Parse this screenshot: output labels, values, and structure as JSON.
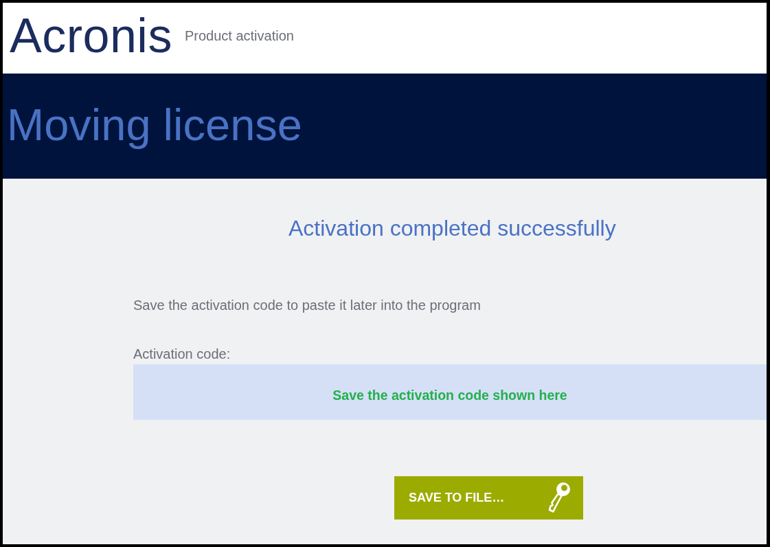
{
  "header": {
    "logo": "Acronis",
    "subtitle": "Product activation"
  },
  "banner": {
    "title": "Moving license"
  },
  "content": {
    "heading": "Activation completed successfully",
    "instruction": "Save the activation code to paste it later into the program",
    "code_label": "Activation code:",
    "code_field": {
      "value": "Save the activation code shown here"
    },
    "save_button": {
      "label": "SAVE TO FILE…"
    }
  }
}
